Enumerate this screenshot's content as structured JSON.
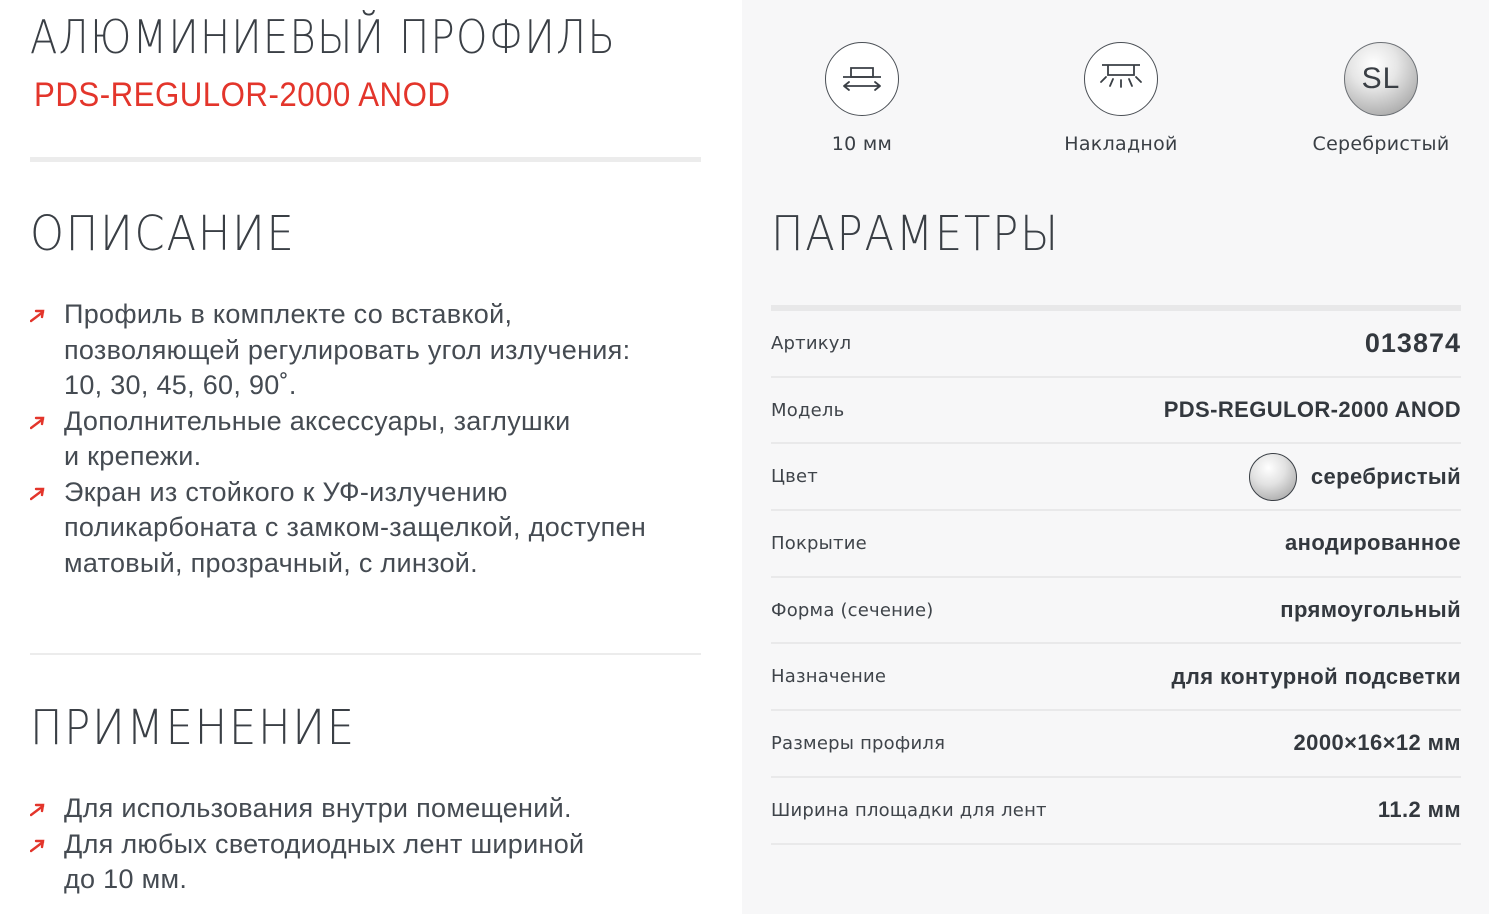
{
  "product": {
    "title": "АЛЮМИНИЕВЫЙ ПРОФИЛЬ",
    "model": "PDS-REGULOR-2000 ANOD"
  },
  "description": {
    "heading": "ОПИСАНИЕ",
    "items": [
      {
        "lines": [
          "Профиль в комплекте со вставкой,",
          "позволяющей регулировать угол излучения:",
          "10, 30, 45, 60, 90˚."
        ]
      },
      {
        "lines": [
          "Дополнительные аксессуары, заглушки",
          "и крепежи."
        ]
      },
      {
        "lines": [
          "Экран из стойкого к УФ-излучению",
          "поликарбоната с замком-защелкой, доступен",
          "матовый, прозрачный, с линзой."
        ]
      }
    ]
  },
  "application": {
    "heading": "ПРИМЕНЕНИЕ",
    "items": [
      {
        "lines": [
          "Для использования внутри помещений."
        ]
      },
      {
        "lines": [
          "Для любых светодиодных лент шириной",
          "до 10 мм."
        ]
      }
    ]
  },
  "features": [
    {
      "icon": "tape-width-icon",
      "label": "10 мм"
    },
    {
      "icon": "surface-mount-icon",
      "label": "Накладной"
    },
    {
      "icon": "silver-color-icon",
      "icon_text": "SL",
      "label": "Серебристый"
    }
  ],
  "parameters": {
    "heading": "ПАРАМЕТРЫ",
    "rows": [
      {
        "key": "Артикул",
        "value": "013874"
      },
      {
        "key": "Модель",
        "value": "PDS-REGULOR-2000 ANOD"
      },
      {
        "key": "Цвет",
        "value": "серебристый"
      },
      {
        "key": "Покрытие",
        "value": "анодированное"
      },
      {
        "key": "Форма (сечение)",
        "value": "прямоугольный"
      },
      {
        "key": "Назначение",
        "value": "для контурной подсветки"
      },
      {
        "key": "Размеры профиля",
        "value": "2000×16×12 мм"
      },
      {
        "key": "Ширина площадки для лент",
        "value": "11.2 мм"
      }
    ]
  },
  "colors": {
    "accent": "#e3352b",
    "text": "#3a3f45",
    "panel_bg": "#f7f7f8"
  }
}
